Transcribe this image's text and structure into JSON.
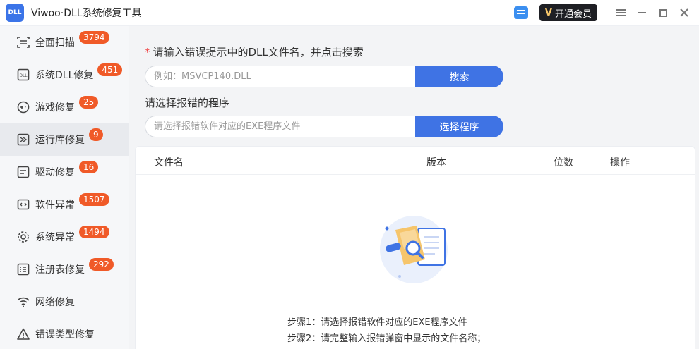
{
  "app": {
    "title": "Viwoo·DLL系统修复工具",
    "logo_text": "DLL",
    "vip_label": "开通会员",
    "vip_mark": "V"
  },
  "sidebar": {
    "items": [
      {
        "label": "全面扫描",
        "badge": "3794",
        "icon": "scan-icon"
      },
      {
        "label": "系统DLL修复",
        "badge": "451",
        "icon": "dll-icon"
      },
      {
        "label": "游戏修复",
        "badge": "25",
        "icon": "game-icon"
      },
      {
        "label": "运行库修复",
        "badge": "9",
        "icon": "runtime-icon"
      },
      {
        "label": "驱动修复",
        "badge": "16",
        "icon": "driver-icon"
      },
      {
        "label": "软件异常",
        "badge": "1507",
        "icon": "code-icon"
      },
      {
        "label": "系统异常",
        "badge": "1494",
        "icon": "gear-icon"
      },
      {
        "label": "注册表修复",
        "badge": "292",
        "icon": "list-icon"
      },
      {
        "label": "网络修复",
        "badge": "",
        "icon": "wifi-icon"
      },
      {
        "label": "错误类型修复",
        "badge": "",
        "icon": "warning-icon"
      }
    ],
    "active_index": 3
  },
  "main": {
    "dll_label_req": "*",
    "dll_label": "请输入错误提示中的DLL文件名，并点击搜索",
    "dll_placeholder": "例如：MSVCP140.DLL",
    "search_button": "搜索",
    "exe_label": "请选择报错的程序",
    "exe_placeholder": "请选择报错软件对应的EXE程序文件",
    "select_button": "选择程序",
    "table": {
      "columns": [
        "文件名",
        "版本",
        "位数",
        "操作"
      ]
    },
    "steps": [
      "步骤1：请选择报错软件对应的EXE程序文件",
      "步骤2：请完整输入报错弹窗中显示的文件名称；"
    ]
  },
  "colors": {
    "accent": "#3f73e4",
    "badge": "#f05a28"
  }
}
